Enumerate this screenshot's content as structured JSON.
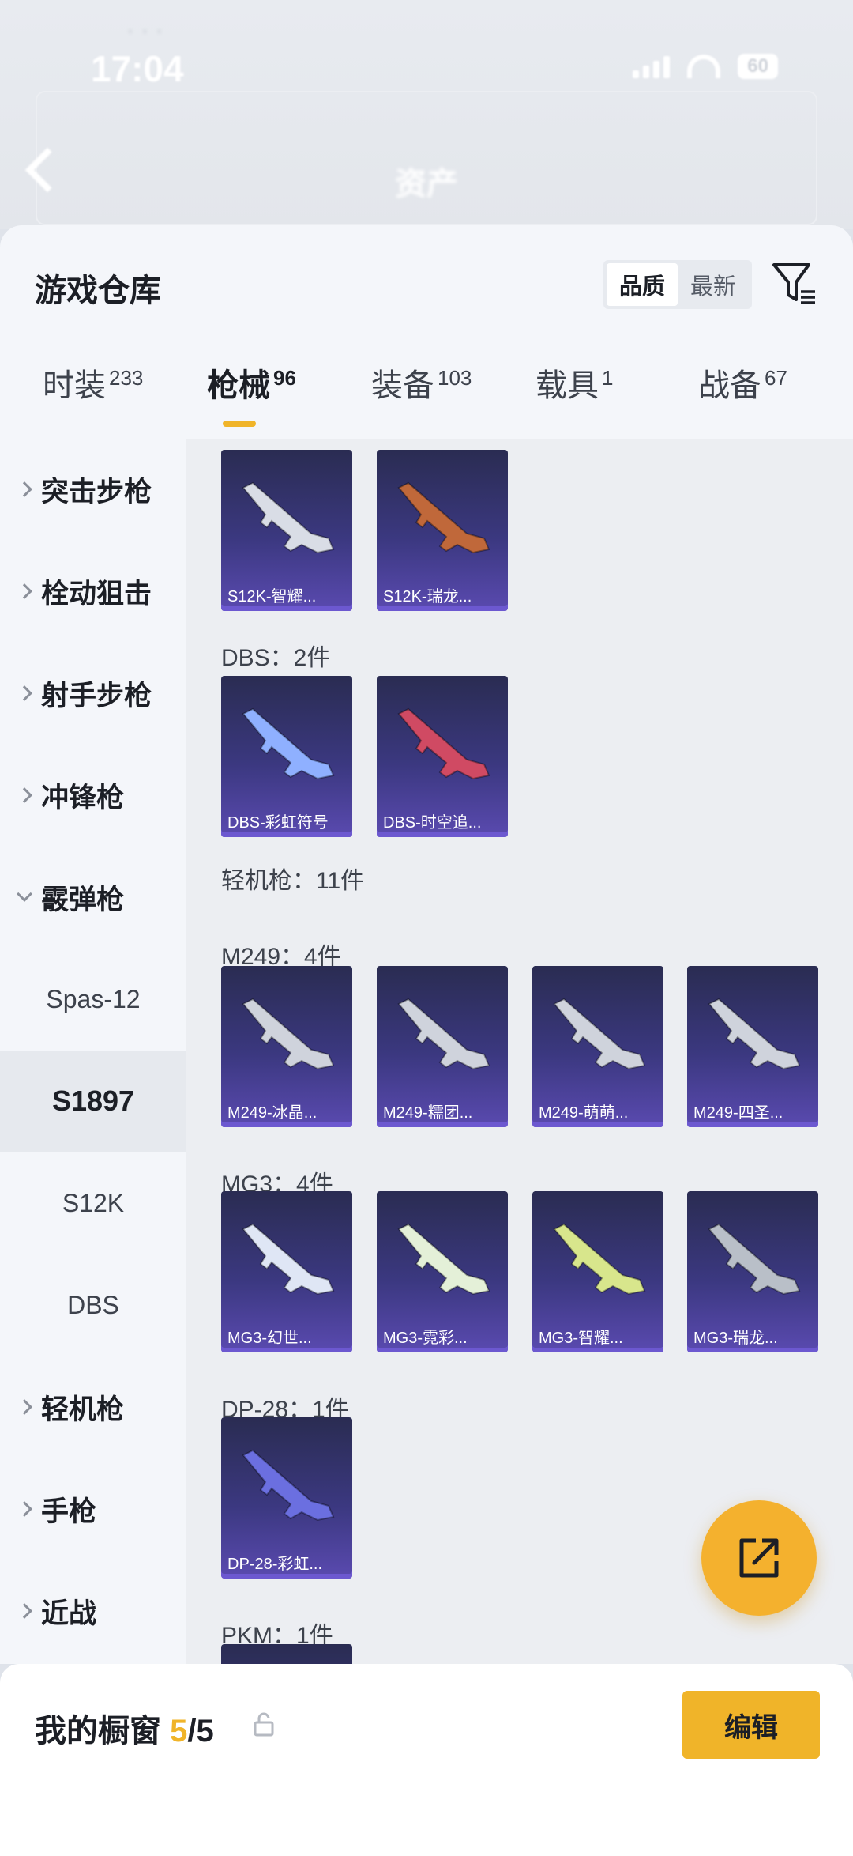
{
  "status_bar": {
    "time": "17:04",
    "battery": "60"
  },
  "header": {
    "title": "资产"
  },
  "sheet": {
    "title": "游戏仓库",
    "sort_options": [
      "品质",
      "最新"
    ],
    "active_sort": "品质"
  },
  "tabs": [
    {
      "label": "时装",
      "count": "233"
    },
    {
      "label": "枪械",
      "count": "96"
    },
    {
      "label": "装备",
      "count": "103"
    },
    {
      "label": "载具",
      "count": "1"
    },
    {
      "label": "战备",
      "count": "67"
    }
  ],
  "sidebar": {
    "categories": [
      {
        "label": "突击步枪",
        "expanded": false
      },
      {
        "label": "栓动狙击",
        "expanded": false
      },
      {
        "label": "射手步枪",
        "expanded": false
      },
      {
        "label": "冲锋枪",
        "expanded": false
      },
      {
        "label": "霰弹枪",
        "expanded": true
      }
    ],
    "subs": [
      "Spas-12",
      "S1897",
      "S12K",
      "DBS"
    ],
    "active_sub": "S1897",
    "categories_after": [
      {
        "label": "轻机枪"
      },
      {
        "label": "手枪"
      },
      {
        "label": "近战"
      }
    ]
  },
  "content": {
    "groups": [
      {
        "label": "",
        "items": [
          "S12K-智耀...",
          "S12K-瑞龙..."
        ]
      },
      {
        "label": "DBS：2件",
        "items": [
          "DBS-彩虹符号",
          "DBS-时空追..."
        ]
      },
      {
        "label": "轻机枪：11件",
        "items": []
      },
      {
        "label": "M249：4件",
        "items": [
          "M249-冰晶...",
          "M249-糯团...",
          "M249-萌萌...",
          "M249-四圣..."
        ]
      },
      {
        "label": "MG3：4件",
        "items": [
          "MG3-幻世...",
          "MG3-霓彩...",
          "MG3-智耀...",
          "MG3-瑞龙..."
        ]
      },
      {
        "label": "DP-28：1件",
        "items": [
          "DP-28-彩虹..."
        ]
      },
      {
        "label": "PKM：1件",
        "items": [
          ""
        ]
      }
    ],
    "gun_colors": [
      [
        "#d9dde6",
        "#c0683a"
      ],
      [
        "#8fb0ff",
        "#d04a63"
      ],
      [],
      [],
      [
        "#dfe6f5",
        "#e4f0d8",
        "#d8e68c",
        "#b9bfc8"
      ],
      [
        "#6b6fe0",
        "#c4a6e8",
        "#d7dbe4",
        "#c05a3a"
      ],
      [
        "#6fd0e8"
      ],
      [
        "#d9dde6"
      ]
    ]
  },
  "bottom": {
    "title": "我的橱窗",
    "count_current": "5",
    "count_total": "/5",
    "edit_label": "编辑"
  }
}
